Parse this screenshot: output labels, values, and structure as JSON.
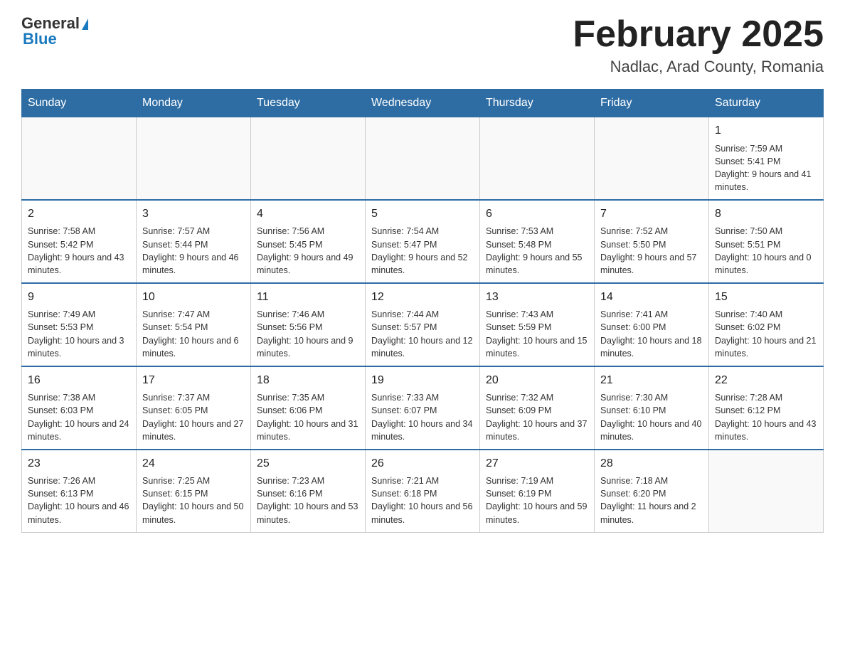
{
  "header": {
    "logo_general": "General",
    "logo_blue": "Blue",
    "title": "February 2025",
    "subtitle": "Nadlac, Arad County, Romania"
  },
  "weekdays": [
    "Sunday",
    "Monday",
    "Tuesday",
    "Wednesday",
    "Thursday",
    "Friday",
    "Saturday"
  ],
  "weeks": [
    [
      {
        "day": "",
        "sunrise": "",
        "sunset": "",
        "daylight": ""
      },
      {
        "day": "",
        "sunrise": "",
        "sunset": "",
        "daylight": ""
      },
      {
        "day": "",
        "sunrise": "",
        "sunset": "",
        "daylight": ""
      },
      {
        "day": "",
        "sunrise": "",
        "sunset": "",
        "daylight": ""
      },
      {
        "day": "",
        "sunrise": "",
        "sunset": "",
        "daylight": ""
      },
      {
        "day": "",
        "sunrise": "",
        "sunset": "",
        "daylight": ""
      },
      {
        "day": "1",
        "sunrise": "Sunrise: 7:59 AM",
        "sunset": "Sunset: 5:41 PM",
        "daylight": "Daylight: 9 hours and 41 minutes."
      }
    ],
    [
      {
        "day": "2",
        "sunrise": "Sunrise: 7:58 AM",
        "sunset": "Sunset: 5:42 PM",
        "daylight": "Daylight: 9 hours and 43 minutes."
      },
      {
        "day": "3",
        "sunrise": "Sunrise: 7:57 AM",
        "sunset": "Sunset: 5:44 PM",
        "daylight": "Daylight: 9 hours and 46 minutes."
      },
      {
        "day": "4",
        "sunrise": "Sunrise: 7:56 AM",
        "sunset": "Sunset: 5:45 PM",
        "daylight": "Daylight: 9 hours and 49 minutes."
      },
      {
        "day": "5",
        "sunrise": "Sunrise: 7:54 AM",
        "sunset": "Sunset: 5:47 PM",
        "daylight": "Daylight: 9 hours and 52 minutes."
      },
      {
        "day": "6",
        "sunrise": "Sunrise: 7:53 AM",
        "sunset": "Sunset: 5:48 PM",
        "daylight": "Daylight: 9 hours and 55 minutes."
      },
      {
        "day": "7",
        "sunrise": "Sunrise: 7:52 AM",
        "sunset": "Sunset: 5:50 PM",
        "daylight": "Daylight: 9 hours and 57 minutes."
      },
      {
        "day": "8",
        "sunrise": "Sunrise: 7:50 AM",
        "sunset": "Sunset: 5:51 PM",
        "daylight": "Daylight: 10 hours and 0 minutes."
      }
    ],
    [
      {
        "day": "9",
        "sunrise": "Sunrise: 7:49 AM",
        "sunset": "Sunset: 5:53 PM",
        "daylight": "Daylight: 10 hours and 3 minutes."
      },
      {
        "day": "10",
        "sunrise": "Sunrise: 7:47 AM",
        "sunset": "Sunset: 5:54 PM",
        "daylight": "Daylight: 10 hours and 6 minutes."
      },
      {
        "day": "11",
        "sunrise": "Sunrise: 7:46 AM",
        "sunset": "Sunset: 5:56 PM",
        "daylight": "Daylight: 10 hours and 9 minutes."
      },
      {
        "day": "12",
        "sunrise": "Sunrise: 7:44 AM",
        "sunset": "Sunset: 5:57 PM",
        "daylight": "Daylight: 10 hours and 12 minutes."
      },
      {
        "day": "13",
        "sunrise": "Sunrise: 7:43 AM",
        "sunset": "Sunset: 5:59 PM",
        "daylight": "Daylight: 10 hours and 15 minutes."
      },
      {
        "day": "14",
        "sunrise": "Sunrise: 7:41 AM",
        "sunset": "Sunset: 6:00 PM",
        "daylight": "Daylight: 10 hours and 18 minutes."
      },
      {
        "day": "15",
        "sunrise": "Sunrise: 7:40 AM",
        "sunset": "Sunset: 6:02 PM",
        "daylight": "Daylight: 10 hours and 21 minutes."
      }
    ],
    [
      {
        "day": "16",
        "sunrise": "Sunrise: 7:38 AM",
        "sunset": "Sunset: 6:03 PM",
        "daylight": "Daylight: 10 hours and 24 minutes."
      },
      {
        "day": "17",
        "sunrise": "Sunrise: 7:37 AM",
        "sunset": "Sunset: 6:05 PM",
        "daylight": "Daylight: 10 hours and 27 minutes."
      },
      {
        "day": "18",
        "sunrise": "Sunrise: 7:35 AM",
        "sunset": "Sunset: 6:06 PM",
        "daylight": "Daylight: 10 hours and 31 minutes."
      },
      {
        "day": "19",
        "sunrise": "Sunrise: 7:33 AM",
        "sunset": "Sunset: 6:07 PM",
        "daylight": "Daylight: 10 hours and 34 minutes."
      },
      {
        "day": "20",
        "sunrise": "Sunrise: 7:32 AM",
        "sunset": "Sunset: 6:09 PM",
        "daylight": "Daylight: 10 hours and 37 minutes."
      },
      {
        "day": "21",
        "sunrise": "Sunrise: 7:30 AM",
        "sunset": "Sunset: 6:10 PM",
        "daylight": "Daylight: 10 hours and 40 minutes."
      },
      {
        "day": "22",
        "sunrise": "Sunrise: 7:28 AM",
        "sunset": "Sunset: 6:12 PM",
        "daylight": "Daylight: 10 hours and 43 minutes."
      }
    ],
    [
      {
        "day": "23",
        "sunrise": "Sunrise: 7:26 AM",
        "sunset": "Sunset: 6:13 PM",
        "daylight": "Daylight: 10 hours and 46 minutes."
      },
      {
        "day": "24",
        "sunrise": "Sunrise: 7:25 AM",
        "sunset": "Sunset: 6:15 PM",
        "daylight": "Daylight: 10 hours and 50 minutes."
      },
      {
        "day": "25",
        "sunrise": "Sunrise: 7:23 AM",
        "sunset": "Sunset: 6:16 PM",
        "daylight": "Daylight: 10 hours and 53 minutes."
      },
      {
        "day": "26",
        "sunrise": "Sunrise: 7:21 AM",
        "sunset": "Sunset: 6:18 PM",
        "daylight": "Daylight: 10 hours and 56 minutes."
      },
      {
        "day": "27",
        "sunrise": "Sunrise: 7:19 AM",
        "sunset": "Sunset: 6:19 PM",
        "daylight": "Daylight: 10 hours and 59 minutes."
      },
      {
        "day": "28",
        "sunrise": "Sunrise: 7:18 AM",
        "sunset": "Sunset: 6:20 PM",
        "daylight": "Daylight: 11 hours and 2 minutes."
      },
      {
        "day": "",
        "sunrise": "",
        "sunset": "",
        "daylight": ""
      }
    ]
  ]
}
